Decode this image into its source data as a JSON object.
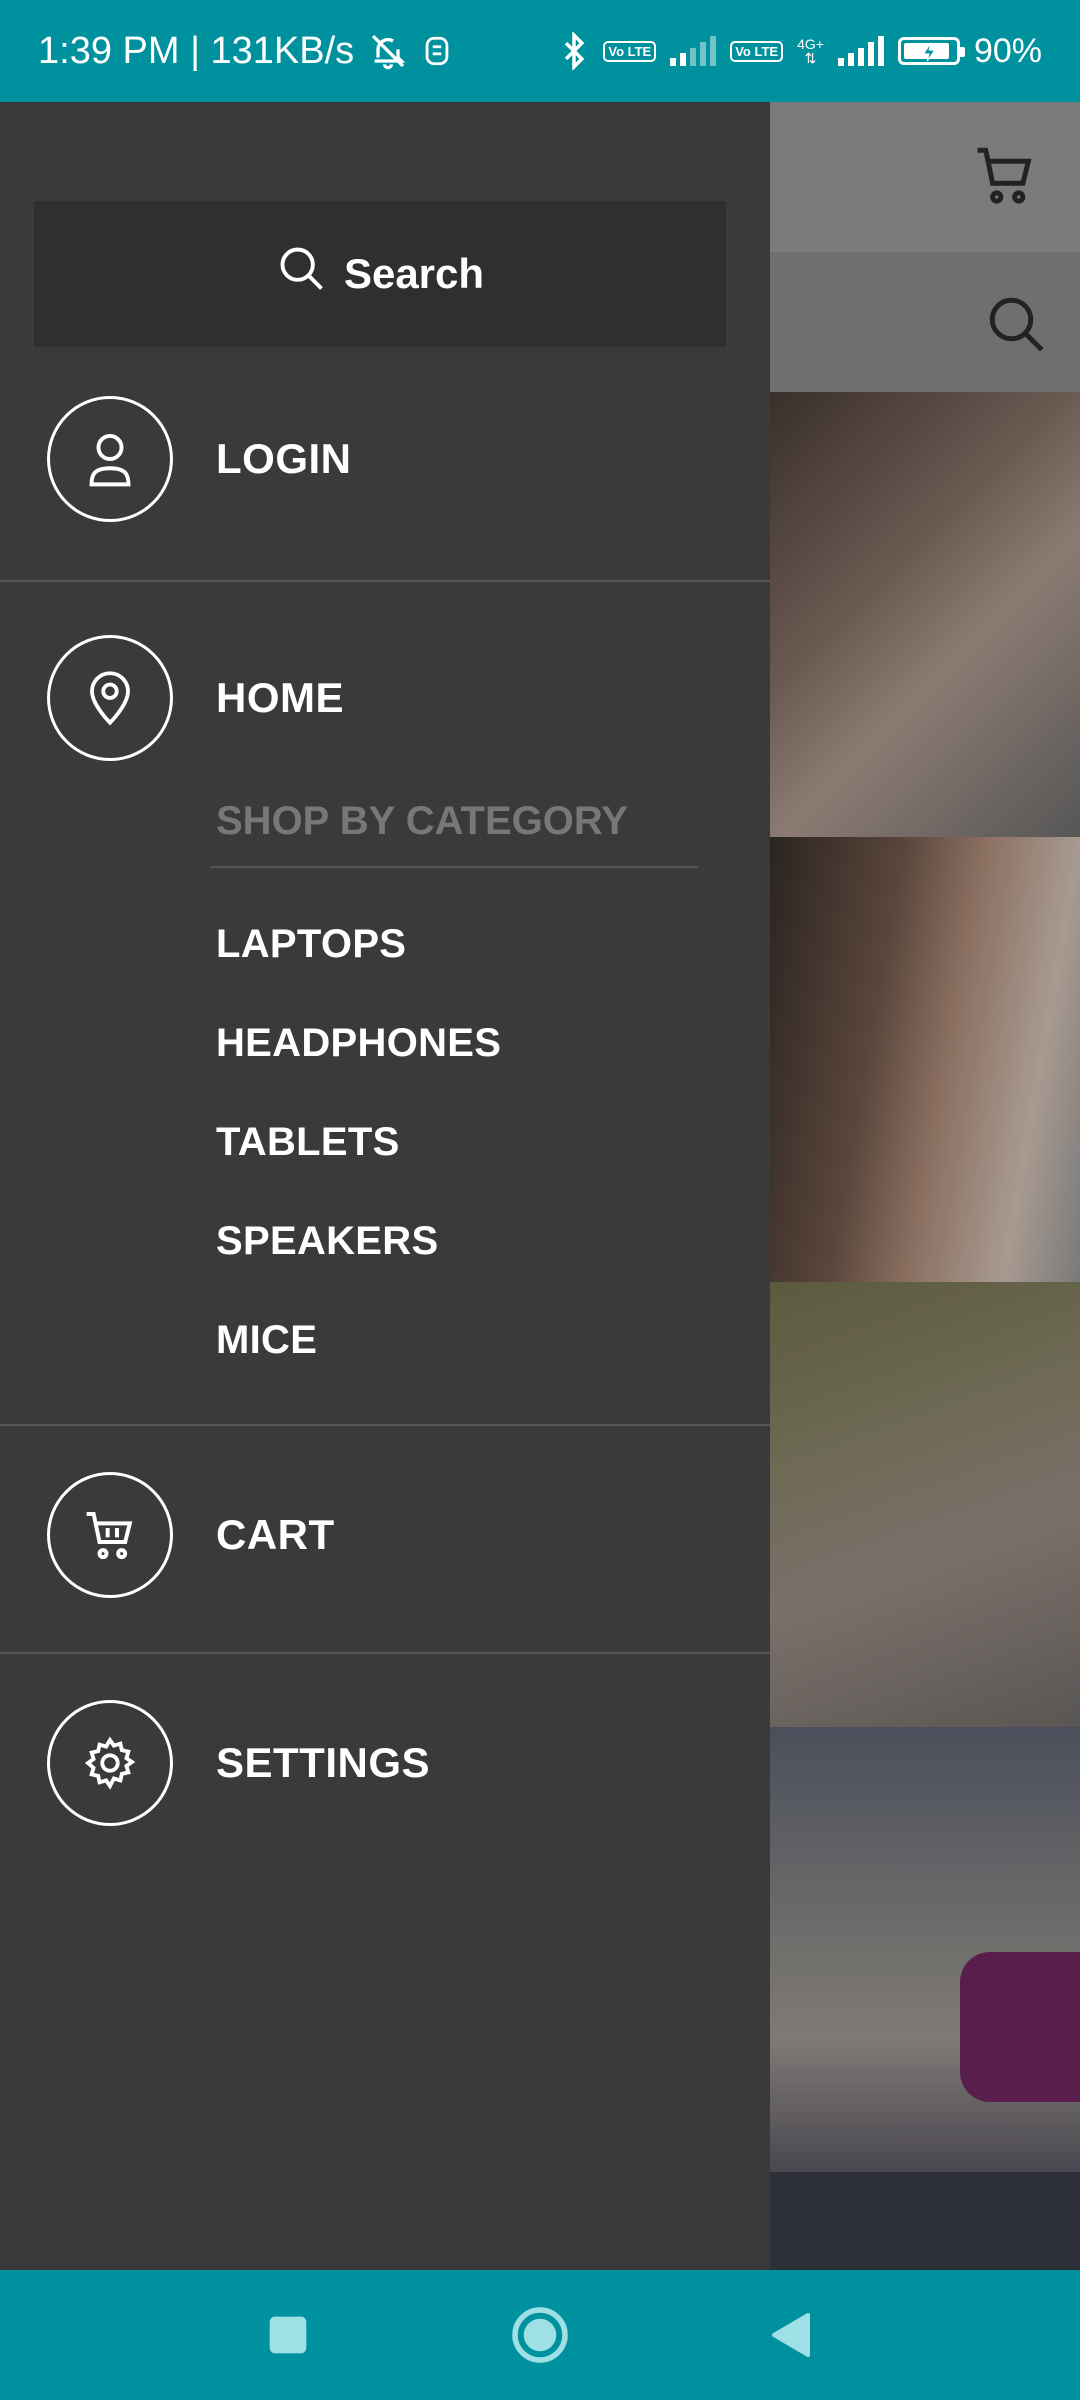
{
  "status_bar": {
    "time_speed": "1:39 PM | 131KB/s",
    "volte1": "Vo LTE",
    "volte2": "Vo LTE",
    "network": "4G+",
    "battery": "90%",
    "battery_level": 0.9
  },
  "drawer": {
    "search_label": "Search",
    "login_label": "LOGIN",
    "home_label": "HOME",
    "category_heading": "SHOP BY CATEGORY",
    "categories": [
      "LAPTOPS",
      "HEADPHONES",
      "TABLETS",
      "SPEAKERS",
      "MICE"
    ],
    "cart_label": "CART",
    "settings_label": "SETTINGS"
  },
  "icons": {
    "search": "search-icon",
    "login": "user-icon",
    "home": "location-pin-icon",
    "cart": "cart-icon",
    "settings": "gear-icon",
    "nav_recents": "square-icon",
    "nav_home": "circle-icon",
    "nav_back": "triangle-back-icon"
  },
  "colors": {
    "status_bar": "#00919f",
    "drawer_bg": "#3a3a3a",
    "search_bg": "#2f2f2f",
    "category_heading": "#777777",
    "nav_icons": "#9fe0e6"
  }
}
